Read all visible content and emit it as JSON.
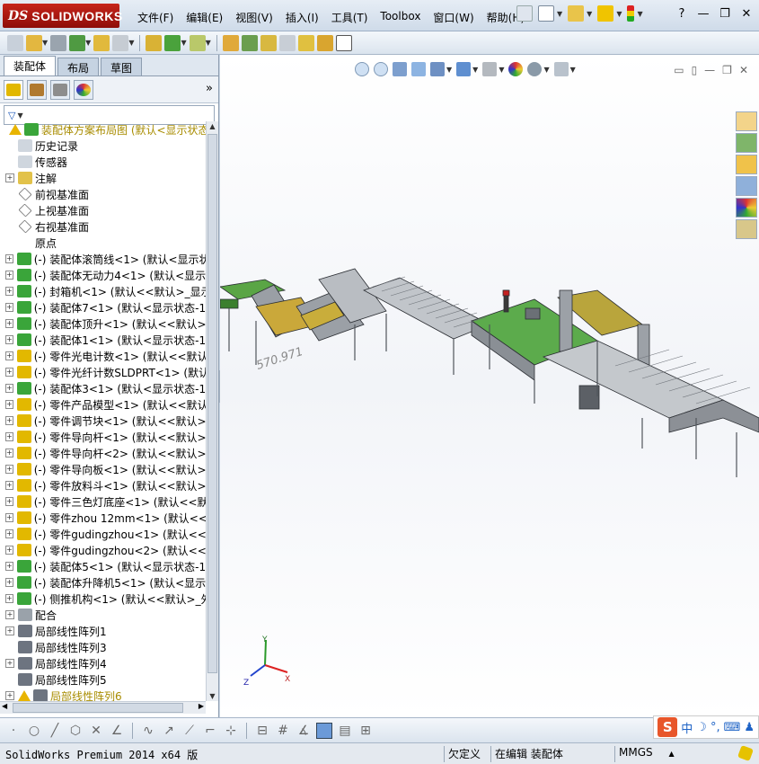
{
  "app": {
    "logo_ds": "DS",
    "logo_name": "SOLIDWORKS"
  },
  "menu": [
    {
      "label": "文件(F)"
    },
    {
      "label": "编辑(E)"
    },
    {
      "label": "视图(V)"
    },
    {
      "label": "插入(I)"
    },
    {
      "label": "工具(T)"
    },
    {
      "label": "Toolbox"
    },
    {
      "label": "窗口(W)"
    },
    {
      "label": "帮助(H)"
    }
  ],
  "window_controls": {
    "help": "?",
    "minimize": "—",
    "restore": "❐",
    "close": "✕"
  },
  "tabs": [
    {
      "label": "装配体"
    },
    {
      "label": "布局"
    },
    {
      "label": "草图"
    }
  ],
  "feature_manager": {
    "expand_symbol": "»",
    "filter_symbol": "▼",
    "tree": [
      {
        "label": "装配体方案布局图  (默认<显示状态",
        "type": "root",
        "warn": true
      },
      {
        "label": "历史记录",
        "type": "history"
      },
      {
        "label": "传感器",
        "type": "sensor"
      },
      {
        "label": "注解",
        "type": "annotation",
        "exp": "+"
      },
      {
        "label": "前视基准面",
        "type": "plane"
      },
      {
        "label": "上视基准面",
        "type": "plane"
      },
      {
        "label": "右视基准面",
        "type": "plane"
      },
      {
        "label": "原点",
        "type": "origin"
      },
      {
        "label": "(-) 装配体滚筒线<1> (默认<显示状",
        "type": "asm",
        "exp": "+"
      },
      {
        "label": "(-) 装配体无动力4<1> (默认<显示",
        "type": "asm",
        "exp": "+"
      },
      {
        "label": "(-) 封箱机<1> (默认<<默认>_显示",
        "type": "asm",
        "exp": "+"
      },
      {
        "label": "(-) 装配体7<1> (默认<显示状态-1",
        "type": "asm",
        "exp": "+"
      },
      {
        "label": "(-) 装配体顶升<1> (默认<<默认>_",
        "type": "asm",
        "exp": "+"
      },
      {
        "label": "(-) 装配体1<1> (默认<显示状态-1",
        "type": "asm",
        "exp": "+"
      },
      {
        "label": "(-) 零件光电计数<1> (默认<<默认",
        "type": "part",
        "exp": "+"
      },
      {
        "label": "(-) 零件光纤计数SLDPRT<1> (默认",
        "type": "part",
        "exp": "+"
      },
      {
        "label": "(-) 装配体3<1> (默认<显示状态-1",
        "type": "asm",
        "exp": "+"
      },
      {
        "label": "(-) 零件产品模型<1> (默认<<默认",
        "type": "part",
        "exp": "+"
      },
      {
        "label": "(-) 零件调节块<1> (默认<<默认>_",
        "type": "part",
        "exp": "+"
      },
      {
        "label": "(-) 零件导向杆<1> (默认<<默认>_",
        "type": "part",
        "exp": "+"
      },
      {
        "label": "(-) 零件导向杆<2> (默认<<默认>_",
        "type": "part",
        "exp": "+"
      },
      {
        "label": "(-) 零件导向板<1> (默认<<默认>_",
        "type": "part",
        "exp": "+"
      },
      {
        "label": "(-) 零件放料斗<1> (默认<<默认>_",
        "type": "part",
        "exp": "+"
      },
      {
        "label": "(-) 零件三色灯底座<1> (默认<<默",
        "type": "part",
        "exp": "+"
      },
      {
        "label": "(-) 零件zhou 12mm<1> (默认<<默",
        "type": "part",
        "exp": "+"
      },
      {
        "label": "(-) 零件gudingzhou<1> (默认<<默",
        "type": "part",
        "exp": "+"
      },
      {
        "label": "(-) 零件gudingzhou<2> (默认<<默",
        "type": "part",
        "exp": "+"
      },
      {
        "label": "(-) 装配体5<1> (默认<显示状态-1",
        "type": "asm",
        "exp": "+"
      },
      {
        "label": "(-) 装配体升降机5<1> (默认<显示",
        "type": "asm",
        "exp": "+"
      },
      {
        "label": "(-) 侧推机构<1> (默认<<默认>_外",
        "type": "asm",
        "exp": "+"
      },
      {
        "label": "配合",
        "type": "mates",
        "exp": "+"
      },
      {
        "label": "局部线性阵列1",
        "type": "pattern",
        "exp": "+"
      },
      {
        "label": "局部线性阵列3",
        "type": "pattern"
      },
      {
        "label": "局部线性阵列4",
        "type": "pattern",
        "exp": "+"
      },
      {
        "label": "局部线性阵列5",
        "type": "pattern"
      },
      {
        "label": "局部线性阵列6",
        "type": "pattern",
        "exp": "+",
        "warn": true
      }
    ]
  },
  "viewport": {
    "dimension_label": "570.971",
    "triad": {
      "x": "X",
      "y": "Y",
      "z": "Z"
    }
  },
  "ime": {
    "logo": "S",
    "mode": "中"
  },
  "status": {
    "product": "SolidWorks Premium 2014 x64 版",
    "definition": "欠定义",
    "edit_state": "在编辑 装配体",
    "units": "MMGS",
    "units_arrow": "▲"
  },
  "colors": {
    "accent_red": "#c01a12",
    "warn_yellow": "#e8b400",
    "asm_green": "#3aa53a",
    "part_yellow": "#e2b800",
    "conveyor_gray": "#8c9096",
    "machine_yellow": "#d6c34a",
    "platform_green": "#4aa84a"
  }
}
